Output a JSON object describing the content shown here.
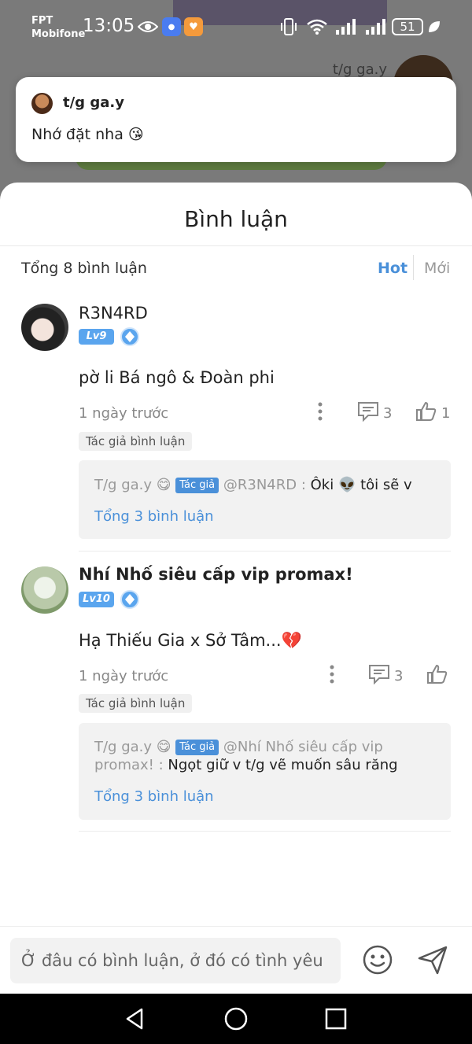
{
  "status_bar": {
    "carrier_line1": "FPT",
    "carrier_line2": "Mobifone",
    "time": "13:05",
    "battery": "51"
  },
  "background": {
    "author": "t/g ga.y"
  },
  "notification": {
    "author": "t/g ga.y",
    "message": "Nhớ đặt nha 😘"
  },
  "sheet": {
    "title": "Bình luận",
    "total": "Tổng 8 bình luận",
    "sort_hot": "Hot",
    "sort_new": "Mới"
  },
  "comments": [
    {
      "name": "R3N4RD",
      "level": "Lv9",
      "text": "pờ li Bá ngô & Đoàn phi",
      "time": "1 ngày trước",
      "reply_count": "3",
      "like_count": "1",
      "tag": "Tác giả bình luận",
      "reply": {
        "author": "T/g ga.y 😋",
        "tag": "Tác giả",
        "mention": "@R3N4RD : ",
        "content": "Ôki 👽 tôi sẽ v",
        "total": "Tổng 3 bình luận"
      }
    },
    {
      "name": "Nhí Nhố siêu cấp vip promax!",
      "level": "Lv10",
      "text": "Hạ Thiếu Gia x Sở Tâm...💔",
      "time": "1 ngày trước",
      "reply_count": "3",
      "like_count": "",
      "tag": "Tác giả bình luận",
      "reply": {
        "author": "T/g ga.y 😋",
        "tag": "Tác giả",
        "mention": "@Nhí Nhố siêu cấp vip promax! : ",
        "content": "Ngọt giữ v t/g vẽ muốn sâu răng",
        "total": "Tổng 3 bình luận"
      }
    }
  ],
  "input": {
    "placeholder": "Ở đâu có bình luận, ở đó có tình yêu"
  },
  "icons": {
    "eye": "eye-icon",
    "vibrate": "vibrate-icon",
    "wifi": "wifi-icon",
    "signal": "signal-icon",
    "leaf": "leaf-icon",
    "more": "more-vertical-icon",
    "reply": "comment-icon",
    "like": "thumbs-up-icon",
    "emoji": "emoji-icon",
    "send": "send-icon",
    "back": "back-icon",
    "home": "home-icon",
    "recents": "recents-icon"
  },
  "colors": {
    "accent": "#4a90d9",
    "level_badge": "#5aa5ee"
  }
}
